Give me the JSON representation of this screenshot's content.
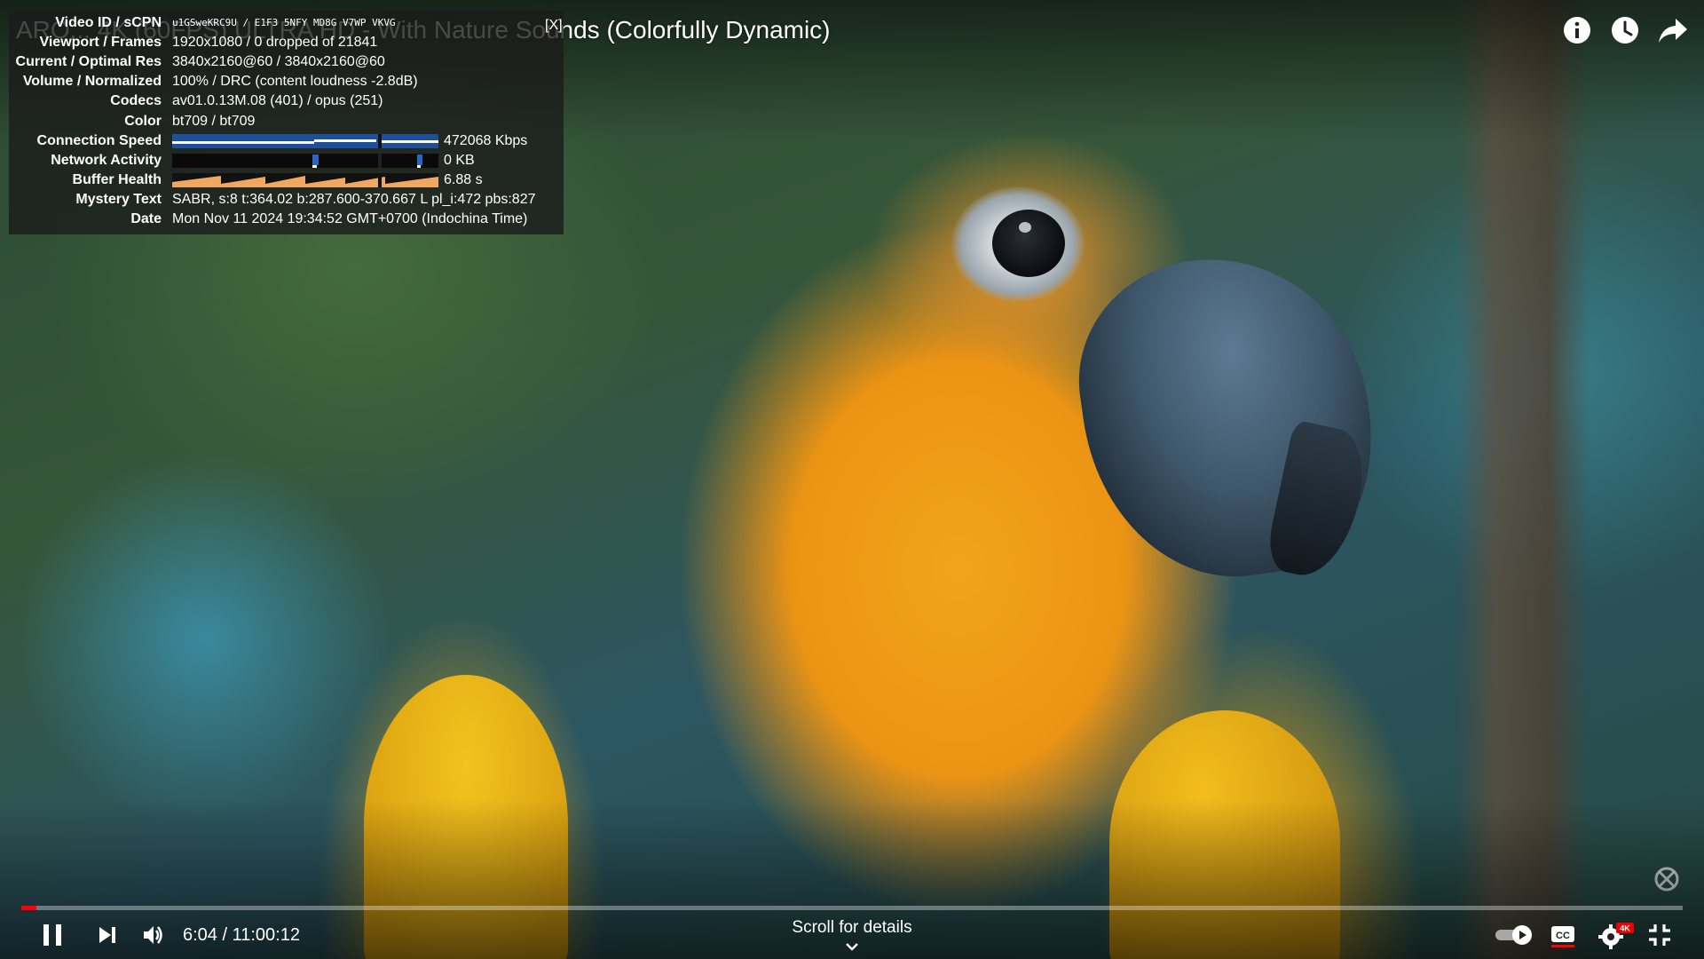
{
  "video": {
    "title": "ARO... 4K (60FPS) ULTRA HD - With Nature Sounds (Colorfully Dynamic)"
  },
  "top_controls": {
    "info_icon": "info-icon",
    "watch_later_icon": "clock-icon",
    "share_icon": "share-icon"
  },
  "stats": {
    "close_label": "[X]",
    "rows": [
      {
        "label": "Video ID / sCPN",
        "value": "u1GSweKRC9U / E1F3 5NFY MD8G V7WP VKVG"
      },
      {
        "label": "Viewport / Frames",
        "value": "1920x1080 / 0 dropped of 21841"
      },
      {
        "label": "Current / Optimal Res",
        "value": "3840x2160@60 / 3840x2160@60"
      },
      {
        "label": "Volume / Normalized",
        "value": "100% / DRC (content loudness -2.8dB)"
      },
      {
        "label": "Codecs",
        "value": "av01.0.13M.08 (401) / opus (251)"
      },
      {
        "label": "Color",
        "value": "bt709 / bt709"
      },
      {
        "label": "Connection Speed",
        "value": "472068 Kbps"
      },
      {
        "label": "Network Activity",
        "value": "0 KB"
      },
      {
        "label": "Buffer Health",
        "value": "6.88 s"
      },
      {
        "label": "Mystery Text",
        "value": "SABR, s:8 t:364.02 b:287.600-370.667 L pl_i:472 pbs:827"
      },
      {
        "label": "Date",
        "value": "Mon Nov 11 2024 19:34:52 GMT+0700 (Indochina Time)"
      }
    ],
    "colors": {
      "speed_graph": "#1e4f9c",
      "network_graph": "#1e4f9c",
      "buffer_graph": "#f0a860"
    }
  },
  "player": {
    "progress_fraction": 0.009,
    "progress_color": "#ff0000",
    "current_time": "6:04",
    "duration": "11:00:12",
    "time_separator": " / ",
    "scroll_hint": "Scroll for details",
    "autoplay_on": true,
    "captions_label": "CC",
    "quality_badge": "4K",
    "icons": [
      "pause-icon",
      "next-icon",
      "volume-icon",
      "autoplay-toggle",
      "cc-icon",
      "settings-icon",
      "exit-fullscreen-icon"
    ]
  }
}
